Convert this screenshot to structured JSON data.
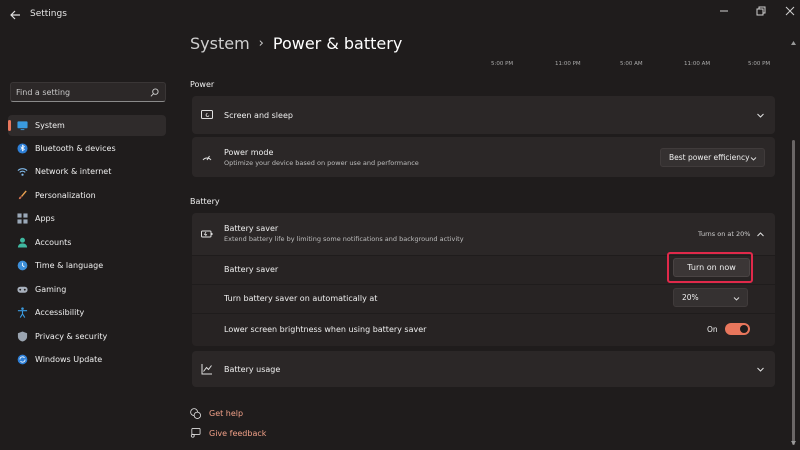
{
  "window": {
    "title": "Settings"
  },
  "search": {
    "placeholder": "Find a setting"
  },
  "nav": [
    {
      "label": "System",
      "icon": "monitor-icon",
      "active": true
    },
    {
      "label": "Bluetooth & devices",
      "icon": "bluetooth-icon"
    },
    {
      "label": "Network & internet",
      "icon": "wifi-icon"
    },
    {
      "label": "Personalization",
      "icon": "brush-icon"
    },
    {
      "label": "Apps",
      "icon": "apps-icon"
    },
    {
      "label": "Accounts",
      "icon": "person-icon"
    },
    {
      "label": "Time & language",
      "icon": "globe-clock-icon"
    },
    {
      "label": "Gaming",
      "icon": "gamepad-icon"
    },
    {
      "label": "Accessibility",
      "icon": "accessibility-icon"
    },
    {
      "label": "Privacy & security",
      "icon": "shield-icon"
    },
    {
      "label": "Windows Update",
      "icon": "update-icon"
    }
  ],
  "breadcrumb": {
    "parent": "System",
    "current": "Power & battery"
  },
  "chart_times": [
    "5:00 PM",
    "11:00 PM",
    "5:00 AM",
    "11:00 AM",
    "5:00 PM"
  ],
  "power": {
    "heading": "Power",
    "screen_sleep": {
      "title": "Screen and sleep"
    },
    "power_mode": {
      "title": "Power mode",
      "subtitle": "Optimize your device based on power use and performance",
      "value": "Best power efficiency"
    }
  },
  "battery": {
    "heading": "Battery",
    "saver": {
      "title": "Battery saver",
      "subtitle": "Extend battery life by limiting some notifications and background activity",
      "status": "Turns on at 20%",
      "row_label": "Battery saver",
      "button": "Turn on now",
      "auto_label": "Turn battery saver on automatically at",
      "auto_value": "20%",
      "brightness_label": "Lower screen brightness when using battery saver",
      "brightness_state": "On"
    },
    "usage": {
      "title": "Battery usage"
    }
  },
  "links": {
    "help": "Get help",
    "feedback": "Give feedback"
  },
  "colors": {
    "accent": "#e8765c",
    "highlight": "#e0294a",
    "background": "#1f1c1c",
    "card": "#2b2727"
  }
}
